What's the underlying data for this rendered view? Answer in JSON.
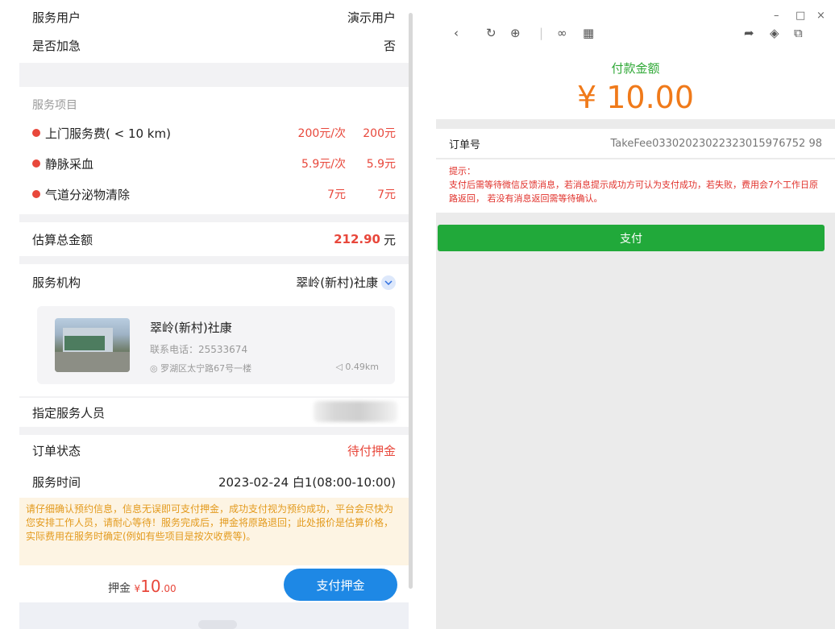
{
  "left": {
    "service_user": {
      "label": "服务用户",
      "value": "演示用户"
    },
    "urgent": {
      "label": "是否加急",
      "value": "否"
    },
    "items_header": "服务项目",
    "items": [
      {
        "name": "上门服务费( < 10 km)",
        "unit": "200元/次",
        "total": "200元"
      },
      {
        "name": "静脉采血",
        "unit": "5.9元/次",
        "total": "5.9元"
      },
      {
        "name": "气道分泌物清除",
        "unit": "7元",
        "total": "7元"
      }
    ],
    "estimate": {
      "label": "估算总金额",
      "value": "212.90",
      "unit": "元"
    },
    "agency": {
      "label": "服务机构",
      "value": "翠岭(新村)社康"
    },
    "card": {
      "title": "翠岭(新村)社康",
      "phone": "联系电话：25533674",
      "address": "罗湖区太宁路67号一楼",
      "distance": "0.49km"
    },
    "staff": {
      "label": "指定服务人员"
    },
    "status": {
      "label": "订单状态",
      "value": "待付押金"
    },
    "time": {
      "label": "服务时间",
      "value": "2023-02-24 白1(08:00-10:00)"
    },
    "notice": "请仔细确认预约信息，信息无误即可支付押金，成功支付视为预约成功，平台会尽快为您安排工作人员，请耐心等待！服务完成后，押金将原路退回；此处报价是估算价格，实际费用在服务时确定(例如有些项目是按次收费等)。",
    "deposit": {
      "label": "押金",
      "currency": "¥",
      "amount": "10",
      "cents": ".00"
    },
    "pay_deposit_button": "支付押金"
  },
  "right": {
    "window_controls": {
      "minimize": "–",
      "maximize": "□",
      "close": "×"
    },
    "pay_title": "付款金额",
    "pay_amount": "¥ 10.00",
    "order": {
      "label": "订单号",
      "value": "TakeFee03302023022323015976752 98"
    },
    "tip_label": "提示：",
    "tip_text": "支付后需等待微信反馈消息，若消息提示成功方可认为支付成功，若失败，费用会7个工作日原路返回， 若没有消息返回需等待确认。",
    "pay_button": "支付"
  },
  "colors": {
    "accent_red": "#e8473b",
    "blue": "#1e88e5",
    "green": "#21a93a",
    "orange": "#f07a1a"
  },
  "icons": [
    "info-dot-icon",
    "chevron-down-icon",
    "location-pin-icon",
    "navigation-arrow-icon",
    "back-icon",
    "refresh-icon",
    "globe-icon",
    "link-icon",
    "qr-icon",
    "share-icon",
    "cube-icon",
    "window-icon"
  ]
}
